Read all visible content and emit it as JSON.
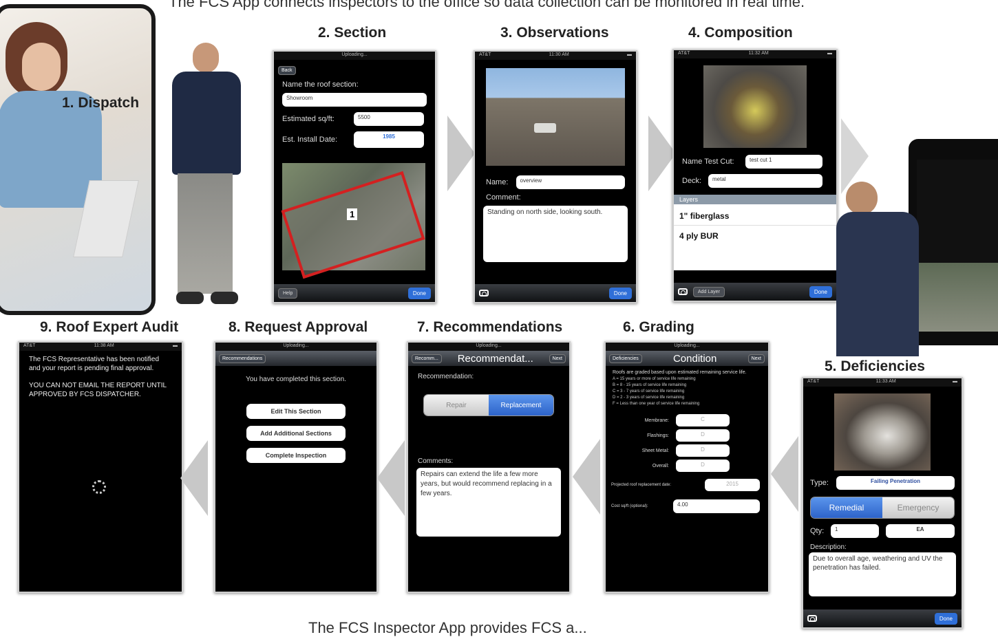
{
  "captions": {
    "top": "The FCS App connects inspectors to the office so data collection can be monitored in real time.",
    "bottom": "The FCS Inspector App provides FCS a..."
  },
  "steps": {
    "dispatch": "1. Dispatch",
    "section": "2. Section",
    "observations": "3. Observations",
    "composition": "4. Composition",
    "deficiencies": "5. Deficiencies",
    "grading": "6. Grading",
    "recommendations": "7. Recommendations",
    "approval": "8. Request Approval",
    "audit": "9. Roof Expert Audit"
  },
  "section_screen": {
    "status": "Uploading...",
    "back": "Back",
    "name_label": "Name the roof section:",
    "name_value": "Showroom",
    "sqft_label": "Estimated sq/ft:",
    "sqft_value": "5500",
    "date_label": "Est. Install Date:",
    "date_value": "1985",
    "map_marker": "1",
    "help": "Help",
    "done": "Done"
  },
  "observations_screen": {
    "carrier": "AT&T",
    "time": "11:30 AM",
    "name_label": "Name:",
    "name_value": "overview",
    "comment_label": "Comment:",
    "comment_value": "Standing on north side, looking south.",
    "done": "Done"
  },
  "composition_screen": {
    "carrier": "AT&T",
    "time": "11:32 AM",
    "testcut_label": "Name Test Cut:",
    "testcut_value": "test cut 1",
    "deck_label": "Deck:",
    "deck_value": "metal",
    "layers_header": "Layers",
    "layers": [
      "1\" fiberglass",
      "4 ply BUR"
    ],
    "add_layer": "Add Layer",
    "done": "Done"
  },
  "deficiencies_screen": {
    "carrier": "AT&T",
    "time": "11:33 AM",
    "type_label": "Type:",
    "type_value": "Failing Penetration",
    "seg_selected": "Remedial",
    "seg_other": "Emergency",
    "qty_label": "Qty:",
    "qty_value": "1",
    "unit_value": "EA",
    "desc_label": "Description:",
    "desc_value": "Due to overall age, weathering and UV the penetration has failed.",
    "done": "Done"
  },
  "grading_screen": {
    "status": "Uploading...",
    "back": "Deficiencies",
    "title": "Condition",
    "next": "Next",
    "intro": "Roofs are graded based upon estimated remaining service life.",
    "grades": [
      "A = 15 years or more of service life remaining",
      "B = 8 - 15 years of service life remaining",
      "C = 3 - 7 years of service life remaining",
      "D = 2 - 3 years of service life remaining",
      "F = Less than one year of service life remaining"
    ],
    "rows": [
      {
        "label": "Membrane:",
        "value": "C"
      },
      {
        "label": "Flashings:",
        "value": "D"
      },
      {
        "label": "Sheet Metal:",
        "value": "D"
      },
      {
        "label": "Overall:",
        "value": "D"
      }
    ],
    "replace_label": "Projected roof replacement date:",
    "replace_value": "2015",
    "cost_label": "Cost sq/ft (optional):",
    "cost_value": "4.00"
  },
  "recommendations_screen": {
    "status": "Uploading...",
    "back": "Recomm...",
    "title": "Recommendat...",
    "next": "Next",
    "rec_label": "Recommendation:",
    "seg_other": "Repair",
    "seg_selected": "Replacement",
    "comments_label": "Comments:",
    "comments_value": "Repairs can extend the life a few more years, but would recommend replacing in a few years."
  },
  "approval_screen": {
    "status": "Uploading...",
    "back": "Recommendations",
    "message": "You have completed this section.",
    "buttons": [
      "Edit This Section",
      "Add Additional Sections",
      "Complete Inspection"
    ]
  },
  "audit_screen": {
    "carrier": "AT&T",
    "time": "11:38 AM",
    "message": "The FCS Representative has been notified and your report is pending final approval.",
    "warning": "YOU CAN NOT EMAIL THE REPORT UNTIL APPROVED BY FCS DISPATCHER."
  },
  "colors": {
    "accent": "#2f6fd8",
    "arrow": "#c8c8c8",
    "map_outline": "#d42020"
  }
}
